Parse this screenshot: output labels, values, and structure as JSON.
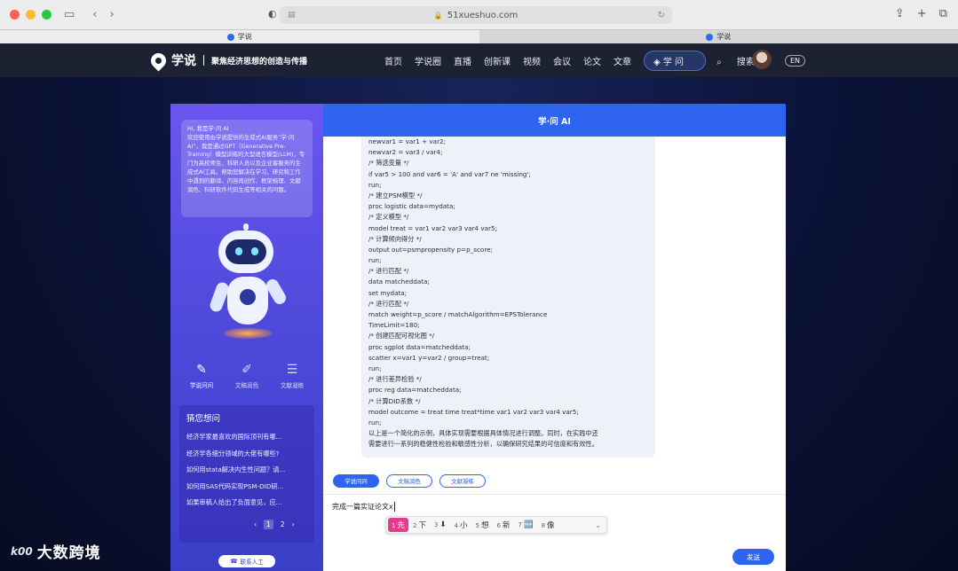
{
  "browser": {
    "url": "51xueshuo.com",
    "tabs": [
      {
        "label": "学说",
        "active": true
      },
      {
        "label": "学说",
        "active": false
      }
    ]
  },
  "site": {
    "logo_name": "学说",
    "slogan": "聚焦经济思想的创造与传播",
    "nav": [
      "首页",
      "学说圈",
      "直播",
      "创新课",
      "视频",
      "会议",
      "论文",
      "文章"
    ],
    "xuewen_label": "学 问",
    "search_label": "搜索",
    "lang_label": "EN"
  },
  "left_panel": {
    "intro": "Hi, 我是学·问 AI\n欢迎使用由学说提供的生成式AI服务“学·问 AI”，我是通过GPT（Generative Pre-Training）模型训练的大型语言模型(LLM)，专门为高校师生、科研人员以及企业客服务的生成式AI工具。帮助您解决在学习、研究和工作中遇到的翻译、内容再创作、框架梳理、文献润色、科研软件代码生成等相关的问题。",
    "tabs": [
      {
        "label": "学说问问",
        "icon": "doc-edit-icon",
        "active": true
      },
      {
        "label": "文稿润色",
        "icon": "doc-pen-icon",
        "active": false
      },
      {
        "label": "文献凝练",
        "icon": "doc-list-icon",
        "active": false
      }
    ],
    "guess_title": "猜您想问",
    "guess_items": [
      "经济学家最喜欢的国际顶刊有哪...",
      "经济学各细分领域的大佬有哪些?",
      "如何用stata解决内生性问题？请...",
      "如何用SAS代码实现PSM-DID研...",
      "如果审稿人给出了负面意见，应..."
    ],
    "pager": {
      "prev": "‹",
      "pages": [
        "1",
        "2"
      ],
      "current": "1",
      "next": "›"
    },
    "contact_label": "联系人工"
  },
  "chat": {
    "title": "学·问 AI",
    "code_lines": [
      "newvar1 = var1 + var2;",
      "newvar2 = var3 / var4;",
      "/* 筛选变量 */",
      "if var5 > 100 and var6 = 'A' and var7 ne 'missing';",
      "run;",
      "/* 建立PSM模型 */",
      "proc logistic data=mydata;",
      "/* 定义模型 */",
      "model treat = var1 var2 var3 var4 var5;",
      "/* 计算倾向得分 */",
      "output out=psmpropensity p=p_score;",
      "run;",
      "/* 进行匹配 */",
      "data matcheddata;",
      "set mydata;",
      "/* 进行匹配 */",
      "match weight=p_score / matchAlgorithm=EPSTolerance",
      "TimeLimit=180;",
      "/* 创建匹配可视化图 */",
      "proc sgplot data=matcheddata;",
      "scatter x=var1 y=var2 / group=treat;",
      "run;",
      "/* 进行差异检验 */",
      "proc reg data=matcheddata;",
      "/* 计算DID系数 */",
      "model outcome = treat time treat*time var1 var2 var3 var4 var5;",
      "run;",
      "以上是一个简化的示例，具体实现需要根据具体情况进行调整。同时，在实践中还",
      "需要进行一系列的稳健性检验和敏感性分析，以确保研究结果的可信度和有效性。"
    ],
    "modes": [
      {
        "label": "学说问问",
        "active": true
      },
      {
        "label": "文稿润色",
        "active": false
      },
      {
        "label": "文献凝练",
        "active": false
      }
    ],
    "input_value": "完成一篇实证论文x",
    "ime_candidates": [
      {
        "num": "1",
        "text": "先"
      },
      {
        "num": "2",
        "text": "下"
      },
      {
        "num": "3",
        "text": "⬇"
      },
      {
        "num": "4",
        "text": "小"
      },
      {
        "num": "5",
        "text": "想"
      },
      {
        "num": "6",
        "text": "新"
      },
      {
        "num": "7",
        "text": "🆕"
      },
      {
        "num": "8",
        "text": "像"
      }
    ],
    "send_label": "发送"
  },
  "watermark": {
    "logo": "k00",
    "text": "大数跨境"
  },
  "colors": {
    "accent": "#2e64f0",
    "header_bg": "#1d2233",
    "ime_select": "#e63c8f"
  }
}
